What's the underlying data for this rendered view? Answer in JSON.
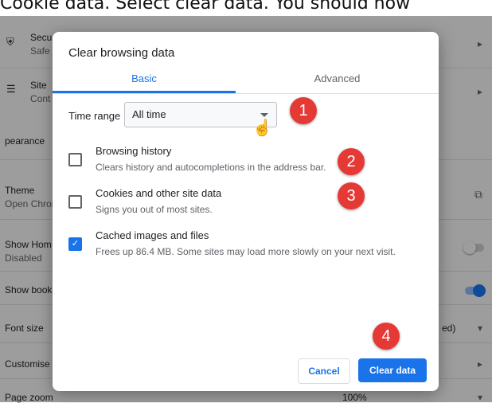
{
  "caption": "Cookie data.  Select clear data.  You should now",
  "background": {
    "rows": [
      {
        "line1": "Secu",
        "line2": "Safe",
        "chevron": "▸"
      },
      {
        "line1": "Site",
        "line2": "Cont",
        "chevron": "▸"
      },
      {
        "line1": "pearance",
        "line2": "",
        "chevron": ""
      },
      {
        "line1": "Theme",
        "line2": "Open Chron",
        "chevron": ""
      },
      {
        "line1": "Show Hom",
        "line2": "Disabled",
        "chevron": ""
      },
      {
        "line1": "Show book",
        "line2": "",
        "chevron": ""
      },
      {
        "line1": "Font size",
        "line2": "",
        "chevron": "▾",
        "value": "ed)"
      },
      {
        "line1": "Customise",
        "line2": "",
        "chevron": "▸"
      },
      {
        "line1": "Page zoom",
        "line2": "",
        "chevron": "▾",
        "value": "100%"
      }
    ]
  },
  "dialog": {
    "title": "Clear browsing data",
    "tabs": {
      "basic": "Basic",
      "advanced": "Advanced"
    },
    "time_range": {
      "label": "Time range",
      "value": "All time"
    },
    "options": [
      {
        "title": "Browsing history",
        "desc": "Clears history and autocompletions in the address bar.",
        "checked": false
      },
      {
        "title": "Cookies and other site data",
        "desc": "Signs you out of most sites.",
        "checked": false
      },
      {
        "title": "Cached images and files",
        "desc": "Frees up 86.4 MB. Some sites may load more slowly on your next visit.",
        "checked": true
      }
    ],
    "buttons": {
      "cancel": "Cancel",
      "clear": "Clear data"
    }
  },
  "badges": [
    "1",
    "2",
    "3",
    "4"
  ],
  "colors": {
    "accent": "#1a73e8",
    "badge": "#e53935"
  }
}
